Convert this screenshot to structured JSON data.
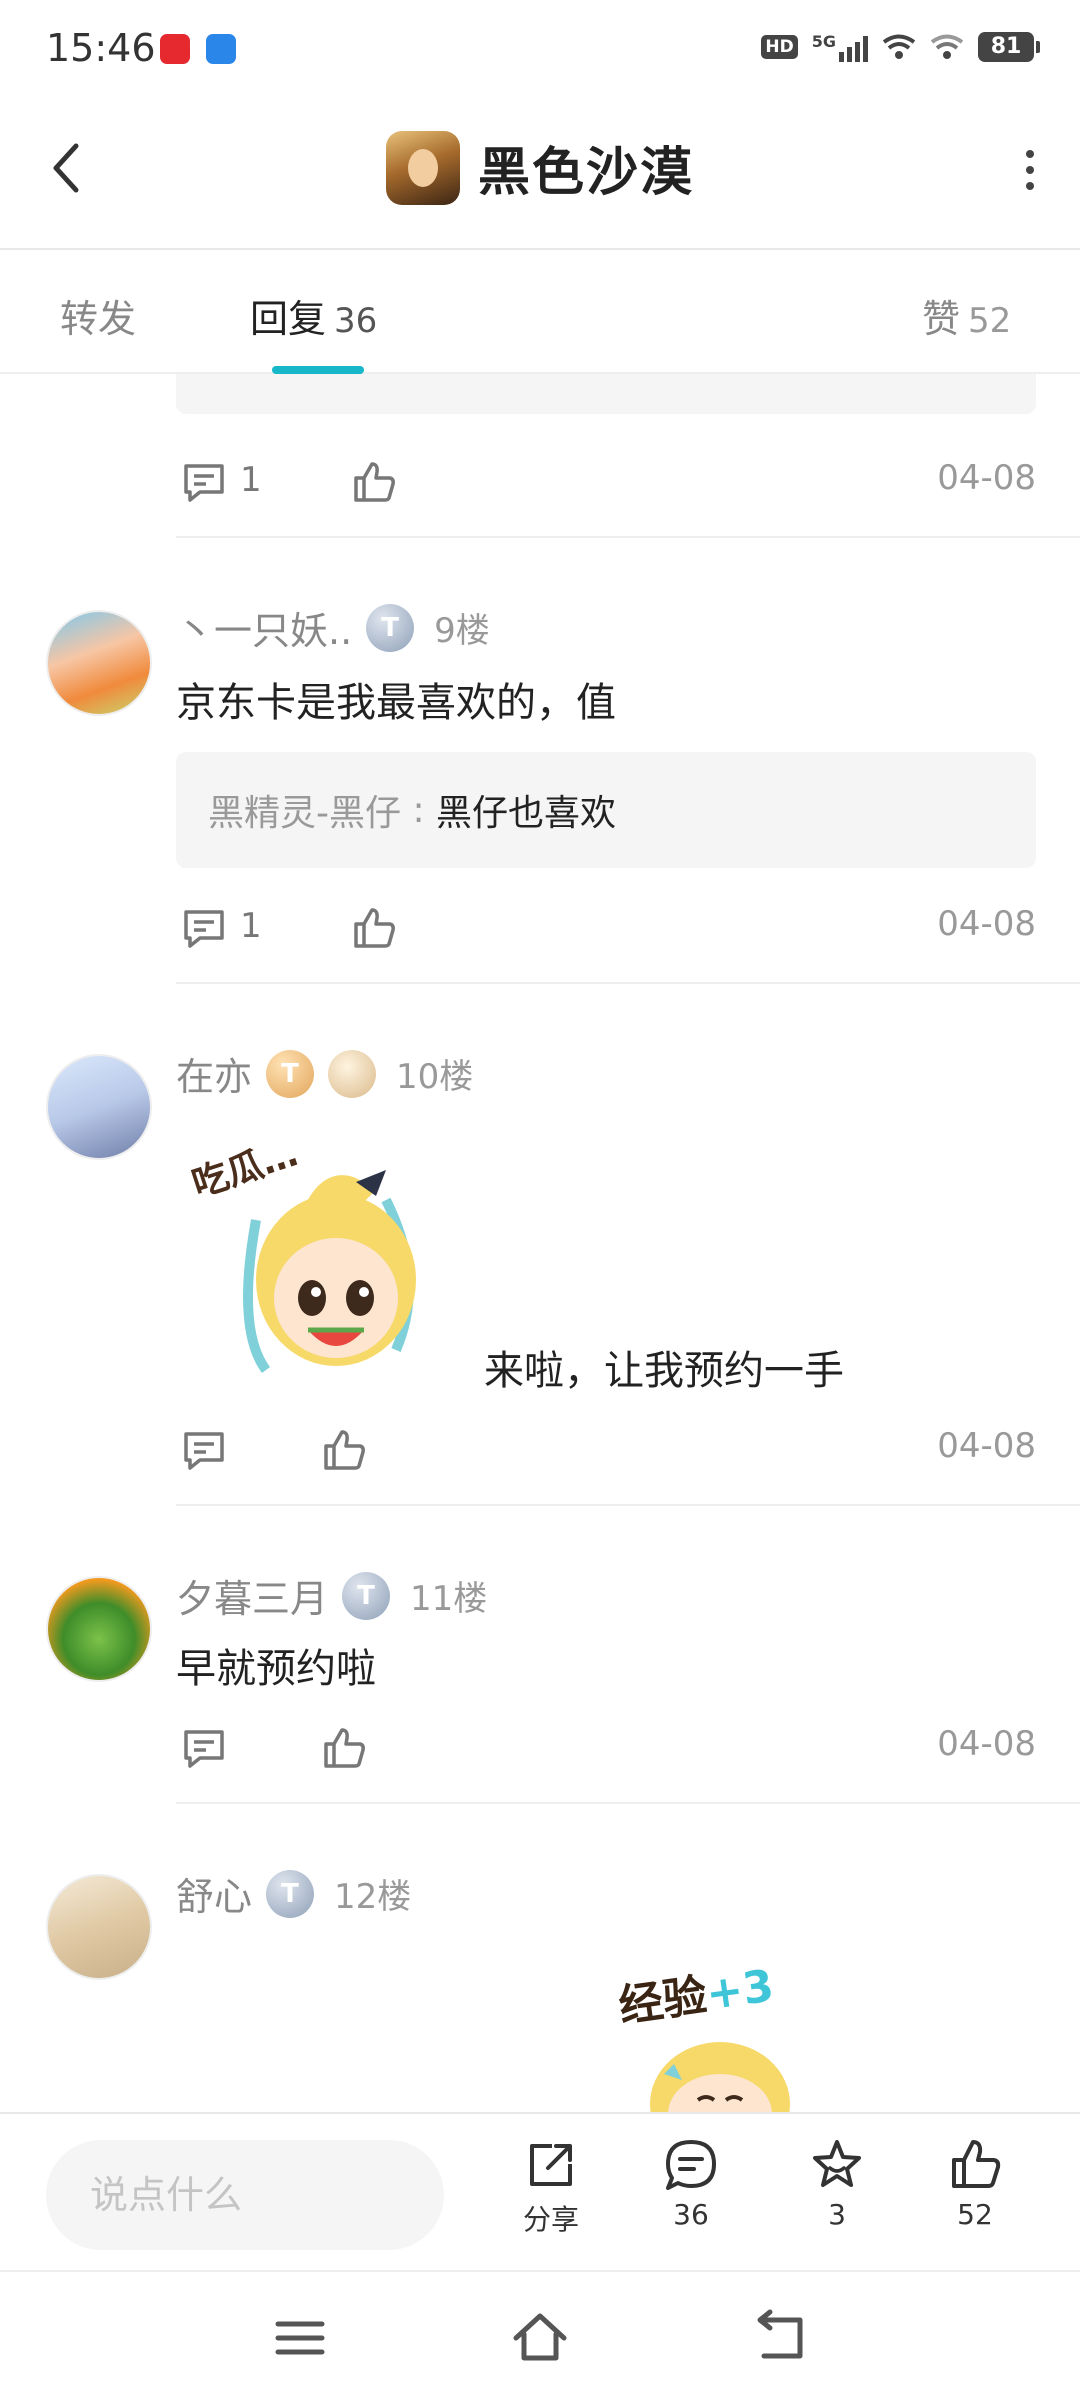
{
  "status_bar": {
    "time": "15:46",
    "hd": "HD",
    "network": "5G",
    "battery": "81"
  },
  "header": {
    "title": "黑色沙漠"
  },
  "tabs": {
    "forward": "转发",
    "reply": "回复",
    "reply_count": "36",
    "like": "赞",
    "like_count": "52"
  },
  "comments": [
    {
      "date": "04-08",
      "reply_count": "1"
    },
    {
      "name": "丶一只妖..",
      "badge": "T",
      "floor": "9楼",
      "text": "京东卡是我最喜欢的，值",
      "quote": {
        "name": "黑精灵-黑仔",
        "text": "黑仔也喜欢"
      },
      "reply_count": "1",
      "date": "04-08"
    },
    {
      "name": "在亦",
      "badge": "T",
      "floor": "10楼",
      "sticker_text": "吃瓜…",
      "text": "来啦，让我预约一手",
      "date": "04-08"
    },
    {
      "name": "夕暮三月",
      "badge": "T",
      "floor": "11楼",
      "text": "早就预约啦",
      "date": "04-08"
    },
    {
      "name": "舒心",
      "badge": "T",
      "floor": "12楼",
      "sticker_text": "经验",
      "sticker_plus": "+3"
    }
  ],
  "bottom_bar": {
    "input_placeholder": "说点什么",
    "share_label": "分享",
    "comment_count": "36",
    "favorite_count": "3",
    "like_count": "52"
  },
  "colors": {
    "accent": "#16b7c9",
    "badge_silver": "#8fa0b8",
    "badge_gold": "#e1a55a"
  }
}
